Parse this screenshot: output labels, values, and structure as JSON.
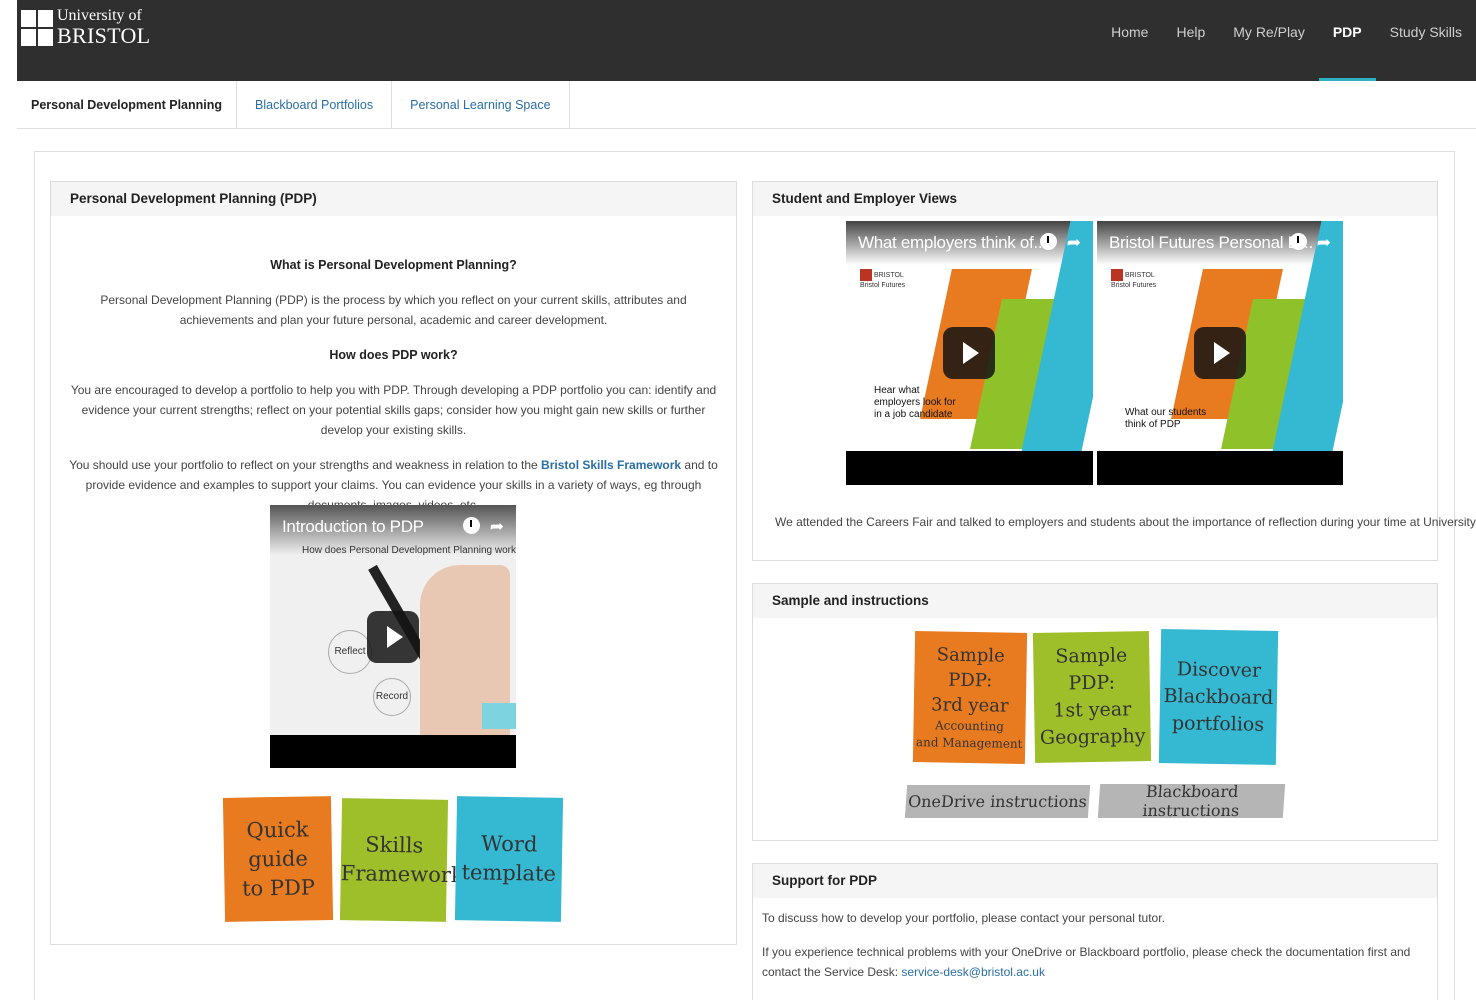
{
  "header": {
    "logo": {
      "line1": "University of",
      "line2": "BRISTOL"
    },
    "nav": [
      "Home",
      "Help",
      "My Re/Play",
      "PDP",
      "Study Skills"
    ],
    "active_nav": "PDP",
    "accent_color": "#2bb3c2"
  },
  "subnav": {
    "tabs": [
      "Personal Development Planning",
      "Blackboard Portfolios",
      "Personal Learning Space"
    ],
    "active": "Personal Development Planning"
  },
  "pdp_panel": {
    "title": "Personal Development Planning (PDP)",
    "what_heading": "What is Personal Development Planning?",
    "what_text": "Personal Development Planning (PDP) is the process by which you reflect on your current skills, attributes and achievements and plan your future personal, academic and career development.",
    "how_heading": "How does PDP work?",
    "how_text": "You are encouraged to develop a portfolio to help you with PDP. Through developing a PDP portfolio you can: identify and evidence your current strengths; reflect on your potential skills gaps; consider how you might gain new skills or further develop your existing skills.",
    "use_text_before": "You should use your portfolio to reflect on your strengths and weakness in relation to the ",
    "use_link": "Bristol Skills Framework",
    "use_text_after": " and to provide evidence and examples to support your claims. You can evidence your skills in a variety of ways, eg through documents, images, videos, etc.",
    "video": {
      "title": "Introduction to PDP",
      "subtitle": "How does Personal Development Planning work?",
      "labels": [
        "Reflect",
        "Record"
      ]
    },
    "tiles": [
      {
        "lines": [
          "Quick",
          "guide",
          "to PDP"
        ],
        "color": "orange"
      },
      {
        "lines": [
          "Skills",
          "Framework"
        ],
        "color": "green"
      },
      {
        "lines": [
          "Word",
          "template"
        ],
        "color": "blue"
      }
    ]
  },
  "views_panel": {
    "title": "Student and Employer Views",
    "videos": [
      {
        "title": "What employers think of...",
        "logo": "BRISTOL",
        "brand": "Bristol Futures",
        "caption": "Hear what employers look for in a job candidate"
      },
      {
        "title": "Bristol Futures Personal D...",
        "logo": "BRISTOL",
        "brand": "Bristol Futures",
        "caption": "What our students think of PDP"
      }
    ],
    "description": "We attended the Careers Fair and talked to employers and students about the importance of reflection during your time at University."
  },
  "sample_panel": {
    "title": "Sample and instructions",
    "tiles": [
      {
        "lines": [
          "Sample PDP:",
          "3rd year"
        ],
        "small": [
          "Accounting",
          "and Management"
        ],
        "color": "orange"
      },
      {
        "lines": [
          "Sample PDP:",
          "1st year",
          "Geography"
        ],
        "small": [],
        "color": "green"
      },
      {
        "lines": [
          "Discover",
          "Blackboard",
          "portfolios"
        ],
        "small": [],
        "color": "blue"
      }
    ],
    "buttons": [
      "OneDrive instructions",
      "Blackboard instructions"
    ]
  },
  "support_panel": {
    "title": "Support for PDP",
    "text1": "To discuss how to develop your portfolio, please contact your personal tutor.",
    "text2": "If you experience technical problems with your OneDrive or Blackboard portfolio, please check the documentation first and contact the Service Desk: ",
    "email": "service-desk@bristol.ac.uk"
  }
}
